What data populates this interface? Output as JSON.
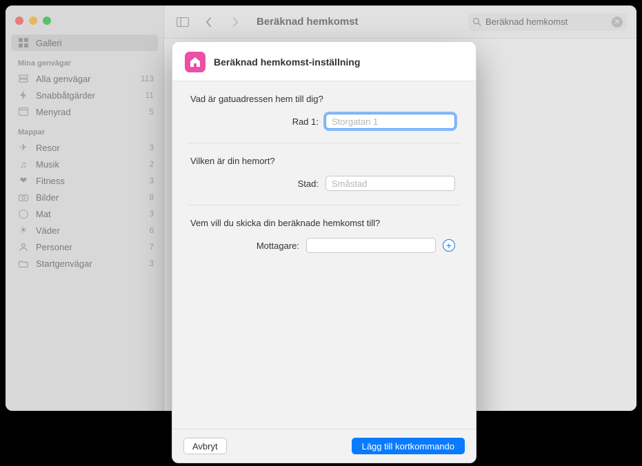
{
  "window": {
    "title": "Beräknad hemkomst"
  },
  "toolbar": {
    "search_value": "Beräknad hemkomst"
  },
  "sidebar": {
    "gallery_label": "Galleri",
    "section_mine": "Mina genvägar",
    "section_folders": "Mappar",
    "mine": [
      {
        "label": "Alla genvägar",
        "count": "113"
      },
      {
        "label": "Snabbåtgärder",
        "count": "11"
      },
      {
        "label": "Menyrad",
        "count": "5"
      }
    ],
    "folders": [
      {
        "label": "Resor",
        "count": "3"
      },
      {
        "label": "Musik",
        "count": "2"
      },
      {
        "label": "Fitness",
        "count": "3"
      },
      {
        "label": "Bilder",
        "count": "8"
      },
      {
        "label": "Mat",
        "count": "3"
      },
      {
        "label": "Väder",
        "count": "6"
      },
      {
        "label": "Personer",
        "count": "7"
      },
      {
        "label": "Startgenvägar",
        "count": "3"
      }
    ]
  },
  "sheet": {
    "title": "Beräknad hemkomst-inställning",
    "q1": "Vad är gatuadressen hem till dig?",
    "row1_label": "Rad 1:",
    "row1_placeholder": "Storgatan 1",
    "q2": "Vilken är din hemort?",
    "city_label": "Stad:",
    "city_placeholder": "Småstad",
    "q3": "Vem vill du skicka din beräknade hemkomst till?",
    "recipient_label": "Mottagare:",
    "cancel": "Avbryt",
    "submit": "Lägg till kortkommando"
  }
}
